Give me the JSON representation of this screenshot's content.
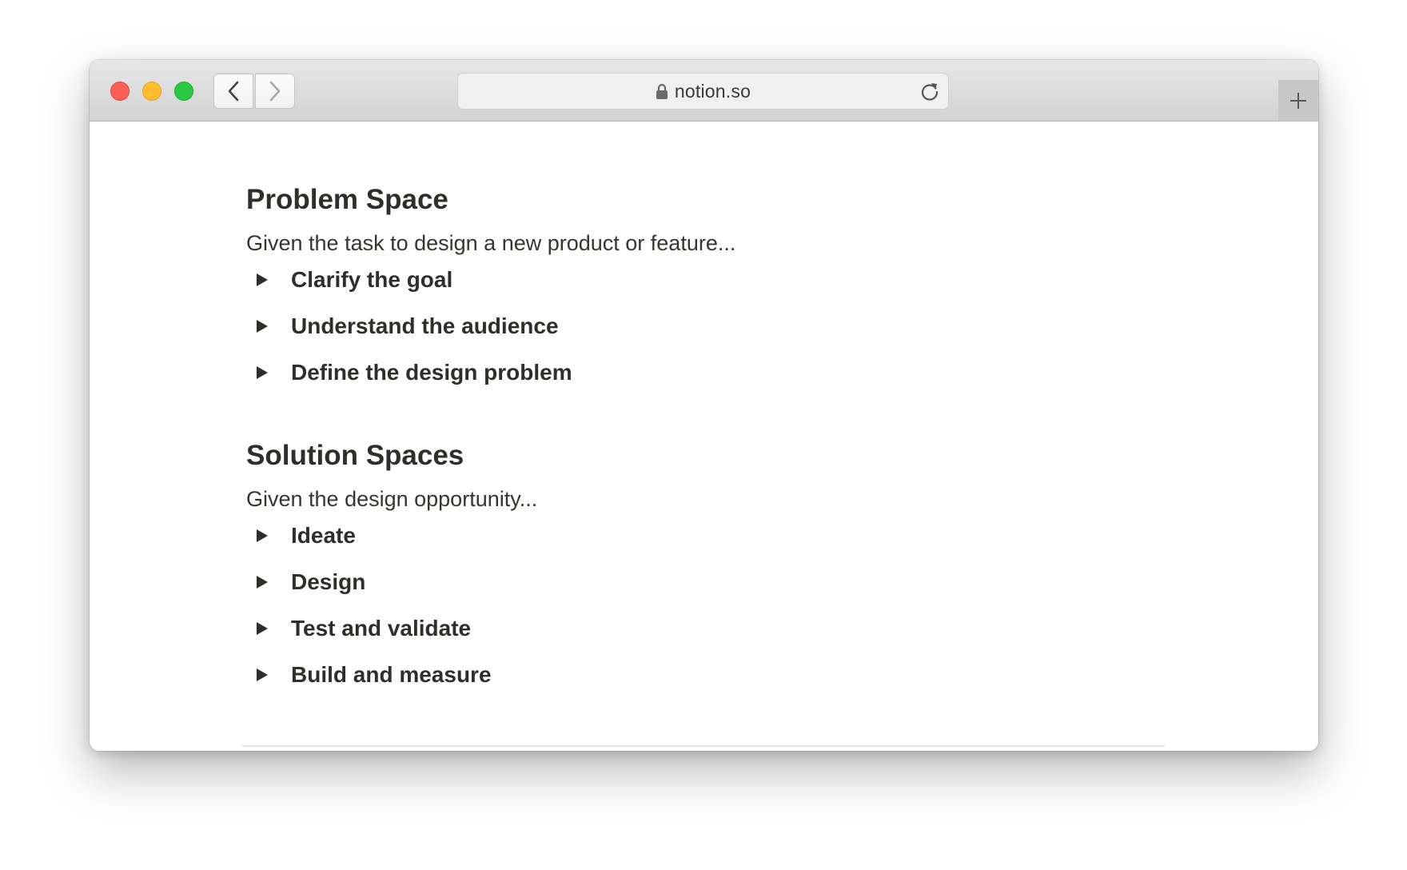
{
  "browser": {
    "url": "notion.so",
    "icons": {
      "back": "chevron-left-icon",
      "forward": "chevron-right-icon",
      "lock": "lock-icon",
      "reload": "reload-icon",
      "new_tab": "plus-icon"
    },
    "traffic_lights": {
      "close": "#fe5f57",
      "minimize": "#febc2e",
      "zoom": "#28c840"
    }
  },
  "page": {
    "sections": [
      {
        "heading": "Problem Space",
        "intro": "Given the task to design a new product or feature...",
        "toggles": [
          "Clarify the goal",
          "Understand the audience",
          "Define the design problem"
        ]
      },
      {
        "heading": "Solution Spaces",
        "intro": "Given the design opportunity...",
        "toggles": [
          "Ideate",
          "Design",
          "Test and validate",
          "Build and measure"
        ]
      }
    ]
  }
}
